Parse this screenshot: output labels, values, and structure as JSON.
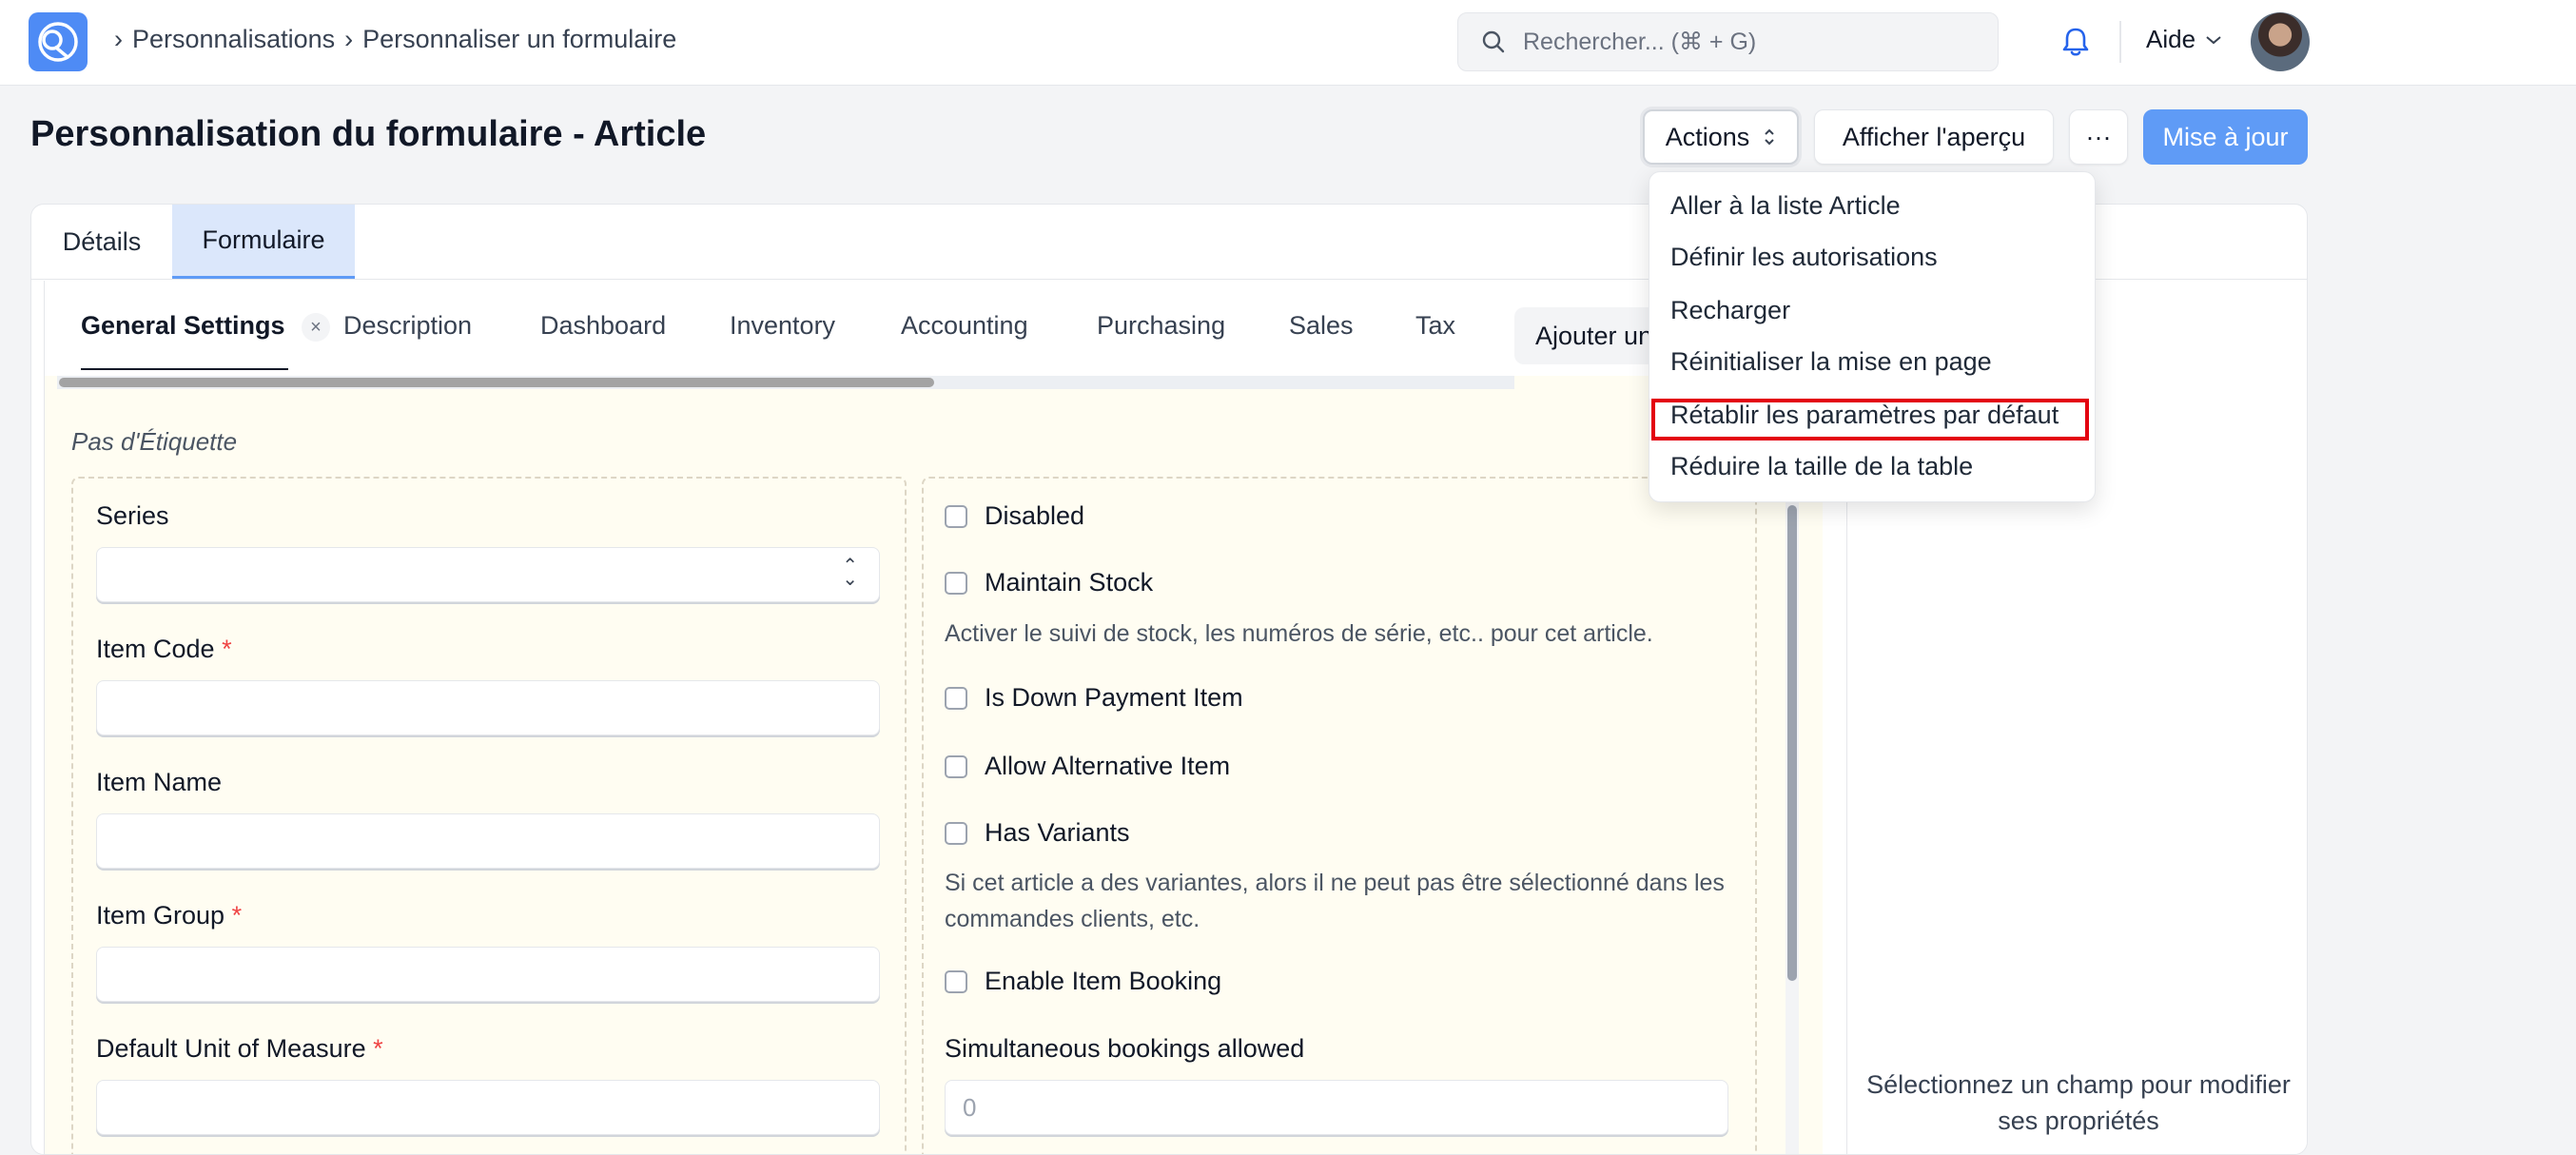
{
  "navbar": {
    "breadcrumb": [
      "Personnalisations",
      "Personnaliser un formulaire"
    ],
    "search_placeholder": "Rechercher... (⌘ + G)",
    "help_label": "Aide"
  },
  "page": {
    "title": "Personnalisation du formulaire - Article",
    "actions_label": "Actions",
    "preview_label": "Afficher l'aperçu",
    "more_label": "···",
    "update_label": "Mise à jour"
  },
  "tabs": [
    "Détails",
    "Formulaire"
  ],
  "section_tabs": [
    "General Settings",
    "Description",
    "Dashboard",
    "Inventory",
    "Accounting",
    "Purchasing",
    "Sales",
    "Tax"
  ],
  "add_tab_label": "Ajouter un onglet",
  "section_label": "Pas d'Étiquette",
  "column1": {
    "fields": [
      {
        "label": "Series",
        "required": ""
      },
      {
        "label": "Item Code",
        "required": "*"
      },
      {
        "label": "Item Name",
        "required": ""
      },
      {
        "label": "Item Group",
        "required": "*"
      },
      {
        "label": "Default Unit of Measure",
        "required": "*"
      }
    ]
  },
  "column2": {
    "disabled": "Disabled",
    "maintain_stock": "Maintain Stock",
    "maintain_stock_help": "Activer le suivi de stock, les numéros de série, etc.. pour cet article.",
    "down_payment": "Is Down Payment Item",
    "alternative": "Allow Alternative Item",
    "has_variants": "Has Variants",
    "has_variants_help": "Si cet article a des variantes, alors il ne peut pas être sélectionné dans les commandes clients, etc.",
    "item_booking": "Enable Item Booking",
    "simultaneous_label": "Simultaneous bookings allowed",
    "simultaneous_value": "0"
  },
  "props_panel": {
    "empty_text": "Sélectionnez un champ pour modifier ses propriétés"
  },
  "actions_menu": [
    "Aller à la liste Article",
    "Définir les autorisations",
    "Recharger",
    "Réinitialiser la mise en page",
    "Rétablir les paramètres par défaut",
    "Réduire la taille de la table"
  ],
  "colors": {
    "accent": "#5f9bf6",
    "highlight_box": "#e3000f",
    "required_star": "#ef4444"
  }
}
